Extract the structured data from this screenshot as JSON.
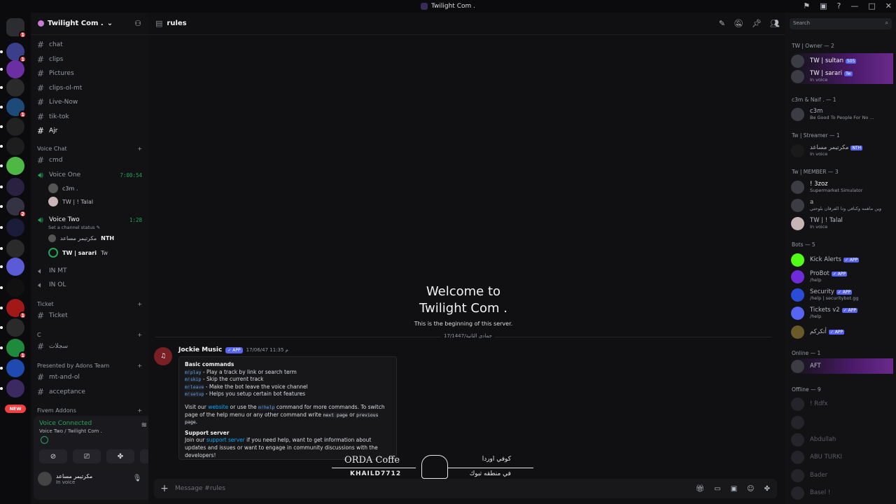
{
  "app": {
    "window_title": "Twilight Com ."
  },
  "servers": {
    "new_badge": "NEW",
    "items": [
      {
        "name": "discord-home",
        "color": "#2b2d31",
        "badge": "1"
      },
      {
        "name": "server-1",
        "color": "#3b3f8a",
        "badge": "1"
      },
      {
        "name": "server-2",
        "color": "#6b2ea3",
        "badge": ""
      },
      {
        "name": "server-3",
        "color": "#2a2a2a",
        "badge": ""
      },
      {
        "name": "server-4",
        "color": "#1e4a7a",
        "badge": "1"
      },
      {
        "name": "server-5",
        "color": "#222",
        "badge": ""
      },
      {
        "name": "server-6",
        "color": "#1d1d1d",
        "badge": ""
      },
      {
        "name": "server-7",
        "color": "#4fb845",
        "badge": ""
      },
      {
        "name": "server-8",
        "color": "#2a2040",
        "badge": ""
      },
      {
        "name": "server-9",
        "color": "#334",
        "badge": "2"
      },
      {
        "name": "server-10",
        "color": "#1b1b3a",
        "badge": ""
      },
      {
        "name": "server-11",
        "color": "#2a2a2a",
        "badge": ""
      },
      {
        "name": "server-12",
        "color": "#5b5bd6",
        "badge": ""
      },
      {
        "name": "server-13",
        "color": "#111",
        "badge": ""
      },
      {
        "name": "server-14",
        "color": "#a01818",
        "badge": "1"
      },
      {
        "name": "server-15",
        "color": "#2a2a2a",
        "badge": ""
      },
      {
        "name": "server-16",
        "color": "#1f8a3c",
        "badge": "1"
      },
      {
        "name": "server-17",
        "color": "#1f4ab0",
        "badge": ""
      },
      {
        "name": "server-18",
        "color": "#3a2a60",
        "badge": ""
      }
    ]
  },
  "guild": {
    "name": "Twilight Com .",
    "channels": [
      {
        "label": "chat",
        "active": false
      },
      {
        "label": "clips",
        "active": false
      },
      {
        "label": "Pictures",
        "active": false
      },
      {
        "label": "clips-ol-mt",
        "active": false
      },
      {
        "label": "Live-Now",
        "active": false
      },
      {
        "label": "tik-tok",
        "active": false
      },
      {
        "label": "Ajr",
        "active": true
      }
    ],
    "voice_category": "Voice Chat",
    "cmd_channel": "cmd",
    "voice_one": {
      "label": "Voice One",
      "timer": "7:00:54",
      "users": [
        "c3m .",
        "TW | ! Talal"
      ]
    },
    "voice_two": {
      "label": "Voice Two",
      "timer": "1:28",
      "status": "Set a channel status",
      "users": [
        {
          "name": "مكرتيمر مساعد",
          "tag": "NTH"
        },
        {
          "name": "TW | sarari",
          "tag": "Tw"
        }
      ]
    },
    "in_mt": "IN MT",
    "in_ol": "IN OL",
    "ticket_category": "Ticket",
    "ticket_channel": "Ticket",
    "c_category": "C",
    "c_channel": "سجلات",
    "adons_category": "Presented by Adons Team",
    "adons_channels": [
      "mt-and-ol",
      "acceptance"
    ],
    "fivem_category": "Fivem Addons"
  },
  "voice_panel": {
    "title": "Voice Connected",
    "subtitle": "Voice Two / Twilight Com ."
  },
  "me": {
    "name": "مكرتيمر مساعد",
    "status": "In voice"
  },
  "channel": {
    "name": "rules"
  },
  "welcome": {
    "line1": "Welcome to",
    "line2": "Twilight Com .",
    "line3": "This is the beginning of this server."
  },
  "date_divider": "17/1447/جمادى الثانية",
  "message": {
    "author": "Jockie Music",
    "app_tag": "APP",
    "time": "17/06/47 11:35 م",
    "embed": {
      "title": "Basic commands",
      "commands": [
        {
          "cmd": "m!play",
          "desc": " - Play a track by link or search term"
        },
        {
          "cmd": "m!skip",
          "desc": " - Skip the current track"
        },
        {
          "cmd": "m!leave",
          "desc": " - Make the bot leave the voice channel"
        },
        {
          "cmd": "m!setup",
          "desc": " - Helps you setup certain bot features"
        }
      ],
      "visit_1": "Visit our ",
      "website": "website",
      "visit_2": " or use the ",
      "help_cmd": "m!help",
      "visit_3": " command for more commands. To switch page of the help menu or any other command write ",
      "next_page": "next page",
      "or": " or ",
      "previous_page": "previous page",
      "dot": ".",
      "support_title": "Support server",
      "join_1": "Join our ",
      "support_link": "support server",
      "join_2": " if you need help, want to get information about updates and issues or want to engage in community discussions with the developers!"
    }
  },
  "composer": {
    "placeholder": "Message #rules"
  },
  "overlay": {
    "brand_en": "ORDA Coffe",
    "handle": "KHAILD7712",
    "brand_ar": "كوفي اوردا",
    "location_ar": "في منطقه تبوك"
  },
  "members": {
    "search_placeholder": "Search",
    "groups": {
      "owner": "TW | Owner — 2",
      "c3m": "c3m & Naif . — 1",
      "streamer": "Tw | Streamer — 1",
      "member": "Tw | MEMBER — 3",
      "bots": "Bots — 5",
      "online": "Online — 1",
      "offline": "Offline — 9"
    },
    "owner": [
      {
        "name": "TW | sultan",
        "sub": "",
        "tag": "505"
      },
      {
        "name": "TW | sarari",
        "sub": "In voice",
        "tag": "Tw"
      }
    ],
    "c3m": [
      {
        "name": "c3m",
        "sub": "Be Good To People For No ..."
      }
    ],
    "streamer": [
      {
        "name": "مكرتيمر مساعد",
        "sub": "In voice",
        "tag": "NTH"
      }
    ],
    "member": [
      {
        "name": "! 3zoz",
        "sub": "Supermarket Simulator"
      },
      {
        "name": "a",
        "sub": "وين ماهمه وكنافي ودا الفرقان بلوحتي"
      },
      {
        "name": "TW | ! Talal",
        "sub": "In voice"
      }
    ],
    "bots": [
      {
        "name": "Kick Alerts",
        "sub": "",
        "color": "#53fc18"
      },
      {
        "name": "ProBot",
        "sub": "/help",
        "color": "#6e2bd9"
      },
      {
        "name": "Security",
        "sub": "/help | securitybot.gg",
        "color": "#2b4cd9"
      },
      {
        "name": "Tickets v2",
        "sub": "/help",
        "color": "#5865f2"
      },
      {
        "name": "أتكركم",
        "sub": "",
        "color": "#6a5a2a"
      }
    ],
    "online": [
      {
        "name": "AFT",
        "sub": ""
      }
    ],
    "offline": [
      "! Rdfx",
      "",
      "Abdullah",
      "ABU TURKI",
      "Bader",
      "Basel !"
    ],
    "app_tag": "APP"
  }
}
